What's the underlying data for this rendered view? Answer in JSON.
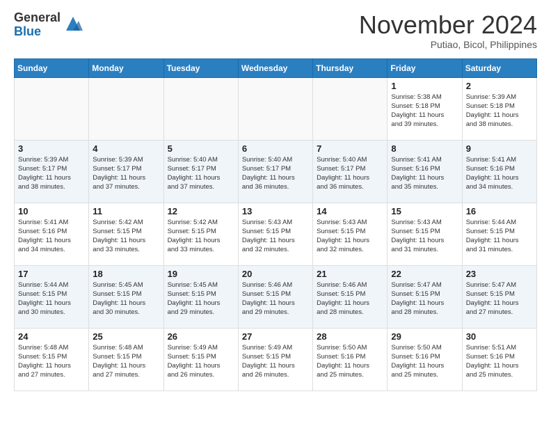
{
  "logo": {
    "general": "General",
    "blue": "Blue"
  },
  "header": {
    "month": "November 2024",
    "location": "Putiao, Bicol, Philippines"
  },
  "weekdays": [
    "Sunday",
    "Monday",
    "Tuesday",
    "Wednesday",
    "Thursday",
    "Friday",
    "Saturday"
  ],
  "weeks": [
    [
      {
        "day": "",
        "info": ""
      },
      {
        "day": "",
        "info": ""
      },
      {
        "day": "",
        "info": ""
      },
      {
        "day": "",
        "info": ""
      },
      {
        "day": "",
        "info": ""
      },
      {
        "day": "1",
        "info": "Sunrise: 5:38 AM\nSunset: 5:18 PM\nDaylight: 11 hours\nand 39 minutes."
      },
      {
        "day": "2",
        "info": "Sunrise: 5:39 AM\nSunset: 5:18 PM\nDaylight: 11 hours\nand 38 minutes."
      }
    ],
    [
      {
        "day": "3",
        "info": "Sunrise: 5:39 AM\nSunset: 5:17 PM\nDaylight: 11 hours\nand 38 minutes."
      },
      {
        "day": "4",
        "info": "Sunrise: 5:39 AM\nSunset: 5:17 PM\nDaylight: 11 hours\nand 37 minutes."
      },
      {
        "day": "5",
        "info": "Sunrise: 5:40 AM\nSunset: 5:17 PM\nDaylight: 11 hours\nand 37 minutes."
      },
      {
        "day": "6",
        "info": "Sunrise: 5:40 AM\nSunset: 5:17 PM\nDaylight: 11 hours\nand 36 minutes."
      },
      {
        "day": "7",
        "info": "Sunrise: 5:40 AM\nSunset: 5:17 PM\nDaylight: 11 hours\nand 36 minutes."
      },
      {
        "day": "8",
        "info": "Sunrise: 5:41 AM\nSunset: 5:16 PM\nDaylight: 11 hours\nand 35 minutes."
      },
      {
        "day": "9",
        "info": "Sunrise: 5:41 AM\nSunset: 5:16 PM\nDaylight: 11 hours\nand 34 minutes."
      }
    ],
    [
      {
        "day": "10",
        "info": "Sunrise: 5:41 AM\nSunset: 5:16 PM\nDaylight: 11 hours\nand 34 minutes."
      },
      {
        "day": "11",
        "info": "Sunrise: 5:42 AM\nSunset: 5:15 PM\nDaylight: 11 hours\nand 33 minutes."
      },
      {
        "day": "12",
        "info": "Sunrise: 5:42 AM\nSunset: 5:15 PM\nDaylight: 11 hours\nand 33 minutes."
      },
      {
        "day": "13",
        "info": "Sunrise: 5:43 AM\nSunset: 5:15 PM\nDaylight: 11 hours\nand 32 minutes."
      },
      {
        "day": "14",
        "info": "Sunrise: 5:43 AM\nSunset: 5:15 PM\nDaylight: 11 hours\nand 32 minutes."
      },
      {
        "day": "15",
        "info": "Sunrise: 5:43 AM\nSunset: 5:15 PM\nDaylight: 11 hours\nand 31 minutes."
      },
      {
        "day": "16",
        "info": "Sunrise: 5:44 AM\nSunset: 5:15 PM\nDaylight: 11 hours\nand 31 minutes."
      }
    ],
    [
      {
        "day": "17",
        "info": "Sunrise: 5:44 AM\nSunset: 5:15 PM\nDaylight: 11 hours\nand 30 minutes."
      },
      {
        "day": "18",
        "info": "Sunrise: 5:45 AM\nSunset: 5:15 PM\nDaylight: 11 hours\nand 30 minutes."
      },
      {
        "day": "19",
        "info": "Sunrise: 5:45 AM\nSunset: 5:15 PM\nDaylight: 11 hours\nand 29 minutes."
      },
      {
        "day": "20",
        "info": "Sunrise: 5:46 AM\nSunset: 5:15 PM\nDaylight: 11 hours\nand 29 minutes."
      },
      {
        "day": "21",
        "info": "Sunrise: 5:46 AM\nSunset: 5:15 PM\nDaylight: 11 hours\nand 28 minutes."
      },
      {
        "day": "22",
        "info": "Sunrise: 5:47 AM\nSunset: 5:15 PM\nDaylight: 11 hours\nand 28 minutes."
      },
      {
        "day": "23",
        "info": "Sunrise: 5:47 AM\nSunset: 5:15 PM\nDaylight: 11 hours\nand 27 minutes."
      }
    ],
    [
      {
        "day": "24",
        "info": "Sunrise: 5:48 AM\nSunset: 5:15 PM\nDaylight: 11 hours\nand 27 minutes."
      },
      {
        "day": "25",
        "info": "Sunrise: 5:48 AM\nSunset: 5:15 PM\nDaylight: 11 hours\nand 27 minutes."
      },
      {
        "day": "26",
        "info": "Sunrise: 5:49 AM\nSunset: 5:15 PM\nDaylight: 11 hours\nand 26 minutes."
      },
      {
        "day": "27",
        "info": "Sunrise: 5:49 AM\nSunset: 5:15 PM\nDaylight: 11 hours\nand 26 minutes."
      },
      {
        "day": "28",
        "info": "Sunrise: 5:50 AM\nSunset: 5:16 PM\nDaylight: 11 hours\nand 25 minutes."
      },
      {
        "day": "29",
        "info": "Sunrise: 5:50 AM\nSunset: 5:16 PM\nDaylight: 11 hours\nand 25 minutes."
      },
      {
        "day": "30",
        "info": "Sunrise: 5:51 AM\nSunset: 5:16 PM\nDaylight: 11 hours\nand 25 minutes."
      }
    ]
  ]
}
